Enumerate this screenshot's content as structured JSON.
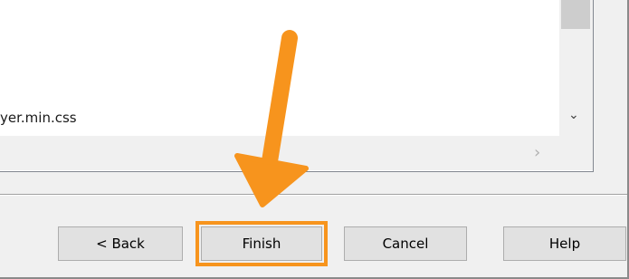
{
  "file_list": {
    "visible_item": "yer.min.css"
  },
  "buttons": {
    "back_label": "< Back",
    "finish_label": "Finish",
    "cancel_label": "Cancel",
    "help_label": "Help"
  },
  "icons": {
    "scroll_down": "chevron-down-icon",
    "scroll_right": "chevron-right-icon",
    "annotation_arrow": "arrow-icon"
  },
  "colors": {
    "highlight": "#f7941d",
    "arrow": "#f7941d"
  }
}
